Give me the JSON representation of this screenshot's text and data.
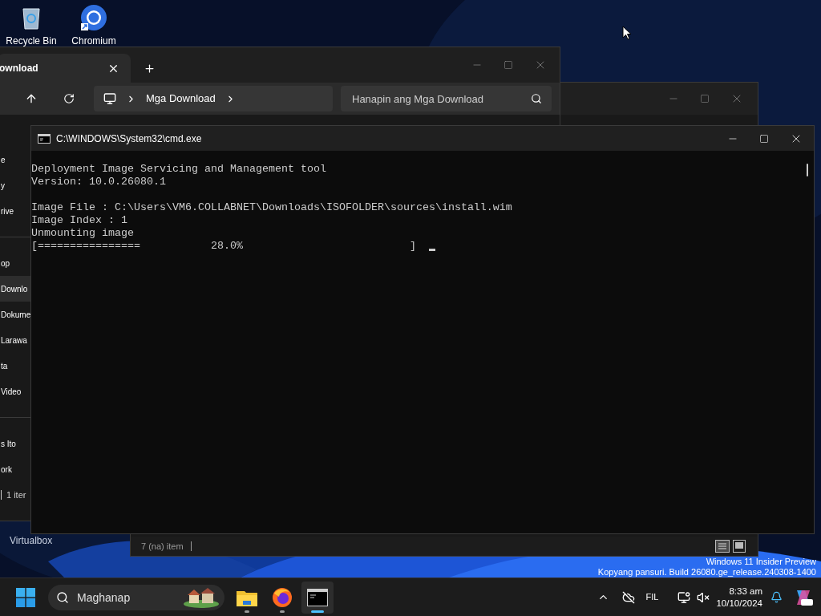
{
  "desktop": {
    "icons": [
      {
        "label": "Recycle Bin",
        "kind": "recycle"
      },
      {
        "label": "Chromium",
        "kind": "chromium"
      }
    ],
    "hidden_icon_label": "Virtualbox",
    "watermark": [
      "Windows 11 Insider Preview",
      "Kopyang pansuri. Build 26080.ge_release.240308-1400"
    ]
  },
  "explorer_back": {
    "status": "7 (na) item"
  },
  "explorer": {
    "tab": {
      "label": "ownload"
    },
    "breadcrumb": [
      "Mga Download"
    ],
    "search": {
      "placeholder": "Hanapin ang Mga Download"
    },
    "sidebar": {
      "groups": [
        [
          {
            "label": "e",
            "selected": false
          },
          {
            "label": "y",
            "selected": false
          },
          {
            "label": "rive",
            "selected": false
          }
        ],
        [
          {
            "label": "op",
            "selected": false
          },
          {
            "label": "Downlo",
            "selected": true
          },
          {
            "label": "Dokume",
            "selected": false
          },
          {
            "label": "Larawa",
            "selected": false
          },
          {
            "label": "ta",
            "selected": false
          },
          {
            "label": "Video",
            "selected": false
          }
        ],
        [
          {
            "label": "s Ito",
            "selected": false
          },
          {
            "label": "ork",
            "selected": false
          }
        ]
      ]
    },
    "status": "1 iter"
  },
  "console": {
    "title": "C:\\WINDOWS\\System32\\cmd.exe",
    "blocks": [
      [
        "Deployment Image Servicing and Management tool",
        "Version: 10.0.26080.1"
      ],
      [
        "Image File : C:\\Users\\VM6.COLLABNET\\Downloads\\ISOFOLDER\\sources\\install.wim",
        "Image Index : 1",
        "Unmounting image",
        "[================           28.0%                          ]"
      ]
    ]
  },
  "taskbar": {
    "search": {
      "placeholder": "Maghanap"
    },
    "apps": [
      {
        "kind": "explorer",
        "selected": false
      },
      {
        "kind": "firefox",
        "selected": false
      },
      {
        "kind": "terminal",
        "selected": true
      }
    ],
    "tray": {
      "language": "FIL",
      "time": "8:33 am",
      "date": "10/10/2024"
    }
  }
}
